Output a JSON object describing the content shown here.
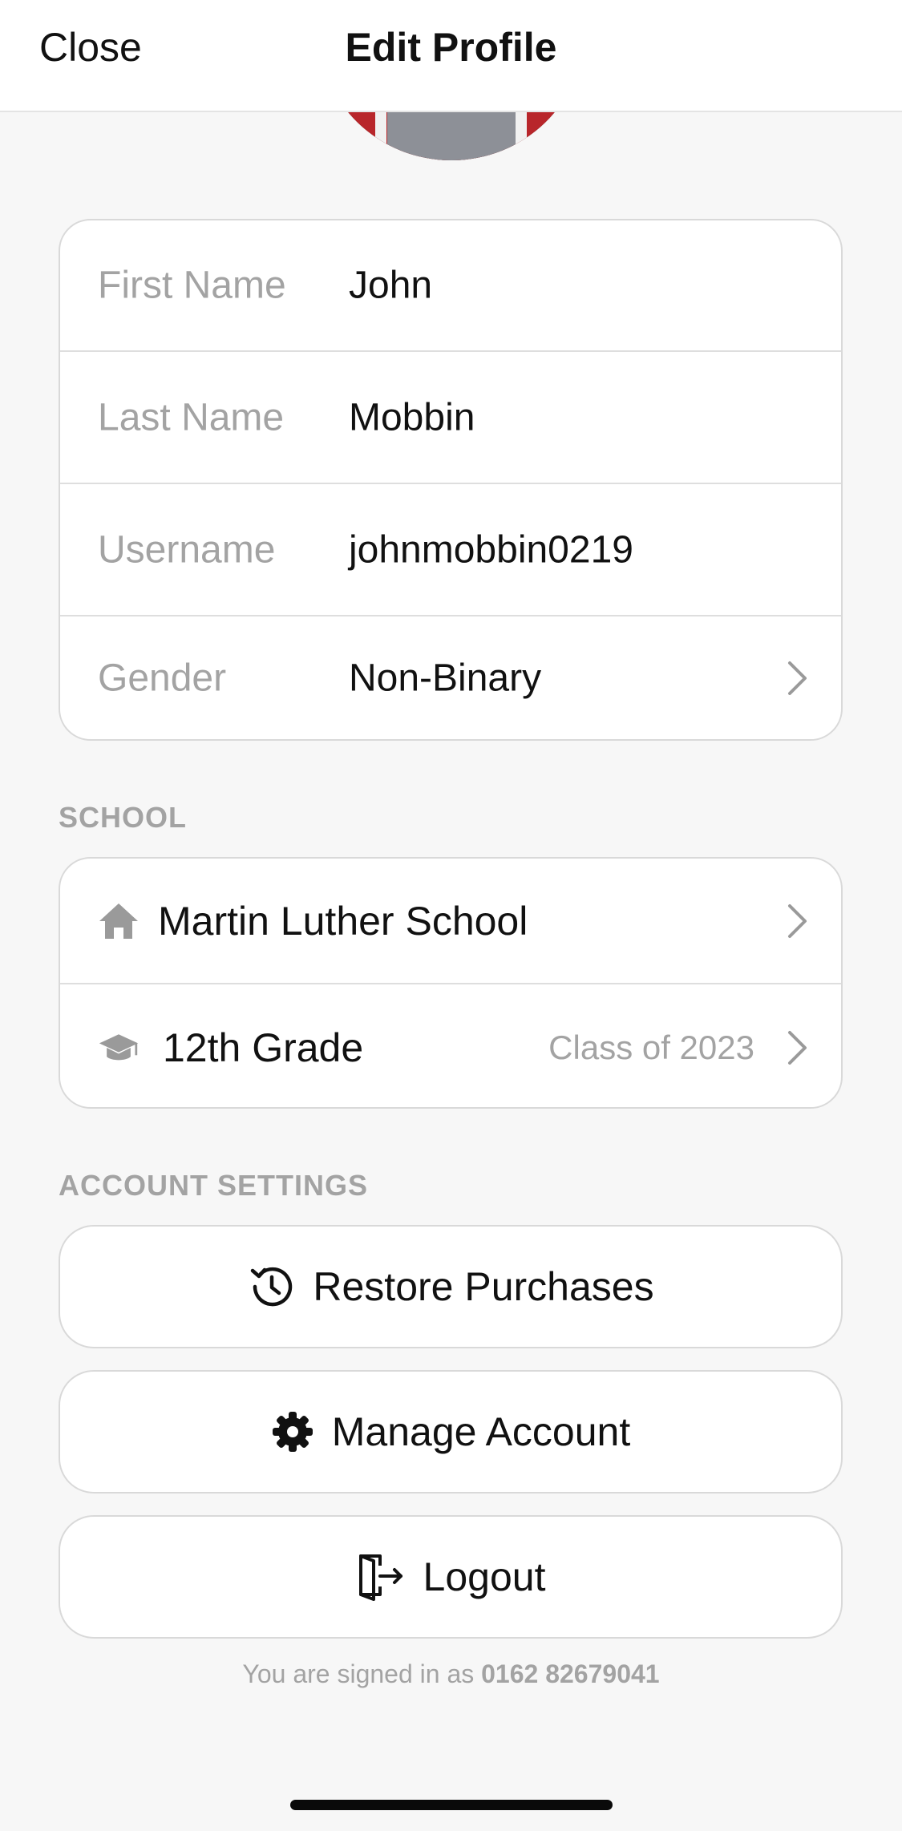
{
  "header": {
    "close_label": "Close",
    "title": "Edit Profile"
  },
  "profile_fields": [
    {
      "label": "First Name",
      "value": "John"
    },
    {
      "label": "Last Name",
      "value": "Mobbin"
    },
    {
      "label": "Username",
      "value": "johnmobbin0219"
    },
    {
      "label": "Gender",
      "value": "Non-Binary"
    }
  ],
  "school_section": {
    "title": "SCHOOL",
    "school_name": "Martin Luther School",
    "grade": "12th Grade",
    "class_of": "Class of 2023"
  },
  "account_section": {
    "title": "ACCOUNT SETTINGS",
    "restore_label": "Restore Purchases",
    "manage_label": "Manage Account",
    "logout_label": "Logout"
  },
  "footer": {
    "signed_in_prefix": "You are signed in as",
    "phone": "0162 82679041"
  },
  "icons": [
    "house-icon",
    "graduation-cap-icon",
    "history-icon",
    "gear-icon",
    "logout-icon",
    "chevron-right-icon"
  ]
}
